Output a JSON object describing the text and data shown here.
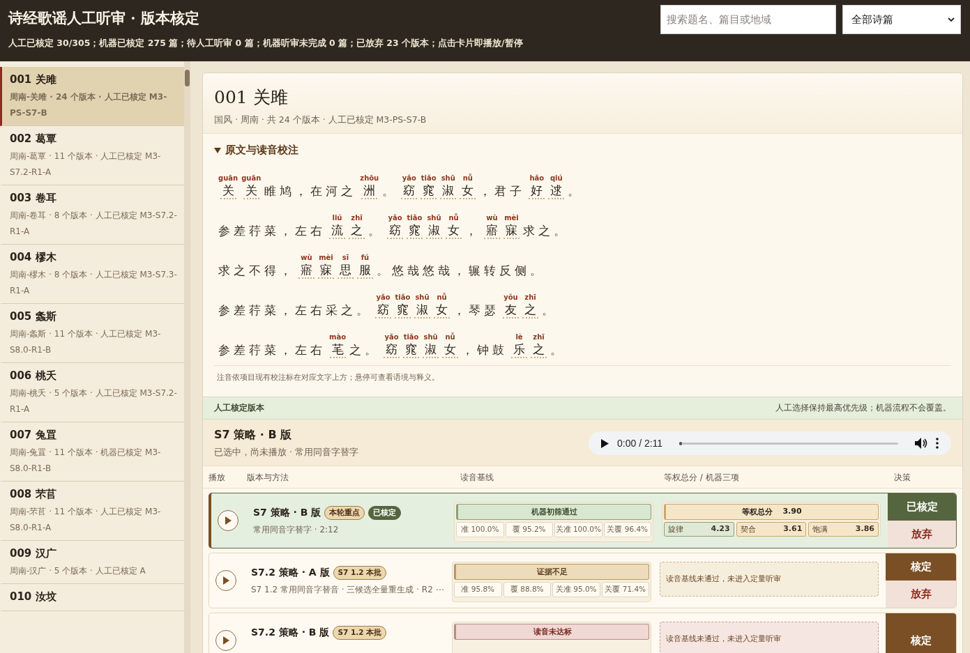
{
  "header": {
    "title": "诗经歌谣人工听审 · 版本核定",
    "summary": "人工已核定 30/305；机器已核定 275 篇；待人工听审 0 篇；机器听审未完成 0 篇；已放弃 23 个版本；点击卡片即播放/暂停",
    "search": {
      "placeholder": "搜索题名、篇目或地域"
    },
    "filter": {
      "value": "全部诗篇"
    }
  },
  "sidebar": {
    "items": [
      {
        "title": "001 关雎",
        "meta": "周南-关雎 · 24 个版本 · 人工已核定 M3-PS-S7-B",
        "selected": true
      },
      {
        "title": "002 葛覃",
        "meta": "周南-葛覃 · 11 个版本 · 人工已核定 M3-S7.2-R1-A",
        "selected": false
      },
      {
        "title": "003 卷耳",
        "meta": "周南-卷耳 · 8 个版本 · 人工已核定 M3-S7.2-R1-A",
        "selected": false
      },
      {
        "title": "004 樛木",
        "meta": "周南-樛木 · 8 个版本 · 人工已核定 M3-S7.3-R1-A",
        "selected": false
      },
      {
        "title": "005 螽斯",
        "meta": "周南-螽斯 · 11 个版本 · 人工已核定 M3-S8.0-R1-B",
        "selected": false
      },
      {
        "title": "006 桃夭",
        "meta": "周南-桃夭 · 5 个版本 · 人工已核定 M3-S7.2-R1-A",
        "selected": false
      },
      {
        "title": "007 兔罝",
        "meta": "周南-兔罝 · 11 个版本 · 机器已核定 M3-S8.0-R1-B",
        "selected": false
      },
      {
        "title": "008 芣苢",
        "meta": "周南-芣苢 · 11 个版本 · 人工已核定 M3-S8.0-R1-A",
        "selected": false
      },
      {
        "title": "009 汉广",
        "meta": "周南-汉广 · 5 个版本 · 人工已核定 A",
        "selected": false
      },
      {
        "title": "010 汝坟",
        "selected": false
      }
    ]
  },
  "poem": {
    "title": "001 关雎",
    "meta": "国风 · 周南 · 共 24 个版本 · 人工已核定 M3-PS-S7-B",
    "section": {
      "label": "原文与读音校注",
      "expanded": true
    },
    "lines": [
      [
        {
          "text": "关",
          "pinyin": "guān"
        },
        {
          "text": "关",
          "pinyin": "guān"
        },
        {
          "text": "睢鸠，在河之"
        },
        {
          "text": "洲",
          "pinyin": "zhōu"
        },
        {
          "text": "。"
        },
        {
          "text": "窈",
          "pinyin": "yǎo"
        },
        {
          "text": "窕",
          "pinyin": "tiǎo"
        },
        {
          "text": "淑",
          "pinyin": "shū"
        },
        {
          "text": "女",
          "pinyin": "nǚ"
        },
        {
          "text": "，君子"
        },
        {
          "text": "好",
          "pinyin": "hǎo"
        },
        {
          "text": "逑",
          "pinyin": "qiú"
        },
        {
          "text": "。"
        }
      ],
      [
        {
          "text": "参差荇菜，左右"
        },
        {
          "text": "流",
          "pinyin": "liú"
        },
        {
          "text": "之",
          "pinyin": "zhī"
        },
        {
          "text": "。"
        },
        {
          "text": "窈",
          "pinyin": "yǎo"
        },
        {
          "text": "窕",
          "pinyin": "tiǎo"
        },
        {
          "text": "淑",
          "pinyin": "shū"
        },
        {
          "text": "女",
          "pinyin": "nǚ"
        },
        {
          "text": "，"
        },
        {
          "text": "寤",
          "pinyin": "wù"
        },
        {
          "text": "寐",
          "pinyin": "mèi"
        },
        {
          "text": "求之。"
        }
      ],
      [
        {
          "text": "求之不得，"
        },
        {
          "text": "寤",
          "pinyin": "wù"
        },
        {
          "text": "寐",
          "pinyin": "mèi"
        },
        {
          "text": "思",
          "pinyin": "sī"
        },
        {
          "text": "服",
          "pinyin": "fú"
        },
        {
          "text": "。悠哉悠哉，辗转反侧。"
        }
      ],
      [
        {
          "text": "参差荇菜，左右采之。"
        },
        {
          "text": "窈",
          "pinyin": "yǎo"
        },
        {
          "text": "窕",
          "pinyin": "tiǎo"
        },
        {
          "text": "淑",
          "pinyin": "shū"
        },
        {
          "text": "女",
          "pinyin": "nǚ"
        },
        {
          "text": "，琴瑟"
        },
        {
          "text": "友",
          "pinyin": "yǒu"
        },
        {
          "text": "之",
          "pinyin": "zhī"
        },
        {
          "text": "。"
        }
      ],
      [
        {
          "text": "参差荇菜，左右"
        },
        {
          "text": "芼",
          "pinyin": "mào"
        },
        {
          "text": "之。"
        },
        {
          "text": "窈",
          "pinyin": "yǎo"
        },
        {
          "text": "窕",
          "pinyin": "tiǎo"
        },
        {
          "text": "淑",
          "pinyin": "shū"
        },
        {
          "text": "女",
          "pinyin": "nǚ"
        },
        {
          "text": "，钟鼓"
        },
        {
          "text": "乐",
          "pinyin": "lè"
        },
        {
          "text": "之",
          "pinyin": "zhī"
        },
        {
          "text": "。"
        }
      ]
    ],
    "note": "注音依项目现有校注标在对应文字上方；悬停可查看语境与释义。"
  },
  "confirmed": {
    "label": "人工核定版本",
    "policy": "人工选择保持最高优先级；机器流程不会覆盖。",
    "version": "S7 策略 · B 版",
    "status": "已选中，尚未播放 · 常用同音字替字",
    "player": {
      "time": "0:00 / 2:11"
    }
  },
  "table": {
    "columns": [
      "播放",
      "版本与方法",
      "读音基线",
      "等权总分 / 机器三项",
      "决策"
    ],
    "rows": [
      {
        "name": "S7 策略 · B 版",
        "tags": [
          {
            "text": "本轮重点",
            "kind": "focus"
          },
          {
            "text": "已核定",
            "kind": "confirmed"
          }
        ],
        "method": "常用同音字替字 · 2:12",
        "confirmed": true,
        "baseline": {
          "status": "机器初筛通过",
          "kind": "pass",
          "metrics": [
            "准 100.0%",
            "覆 95.2%",
            "关准 100.0%",
            "关覆 96.4%"
          ]
        },
        "score": {
          "kind": "scores",
          "total_label": "等权总分",
          "total": "3.90",
          "items": [
            {
              "label": "旋律",
              "value": "4.23",
              "highlighted": true
            },
            {
              "label": "契合",
              "value": "3.61",
              "highlighted": false
            },
            {
              "label": "饱满",
              "value": "3.86",
              "highlighted": false
            }
          ]
        },
        "actions": [
          "已核定",
          "放弃"
        ]
      },
      {
        "name": "S7.2 策略 · A 版",
        "tags": [
          {
            "text": "S7 1.2 本批",
            "kind": "batch"
          }
        ],
        "method": "S7 1.2 常用同音字替音 · 三候选全量重生成 · R2 ⋯",
        "confirmed": false,
        "baseline": {
          "status": "证据不足",
          "kind": "insufficient",
          "metrics": [
            "准 95.8%",
            "覆 88.8%",
            "关准 95.0%",
            "关覆 71.4%"
          ]
        },
        "score": {
          "kind": "note",
          "text": "读音基线未通过，未进入定量听审"
        },
        "actions": [
          "核定",
          "放弃"
        ]
      },
      {
        "name": "S7.2 策略 · B 版",
        "tags": [
          {
            "text": "S7 1.2 本批",
            "kind": "batch"
          }
        ],
        "confirmed": false,
        "baseline": {
          "status": "读音未达标",
          "kind": "fail"
        },
        "score": {
          "kind": "note",
          "text": "读音基线未通过，未进入定量听审"
        },
        "actions": [
          "核定"
        ]
      }
    ]
  }
}
